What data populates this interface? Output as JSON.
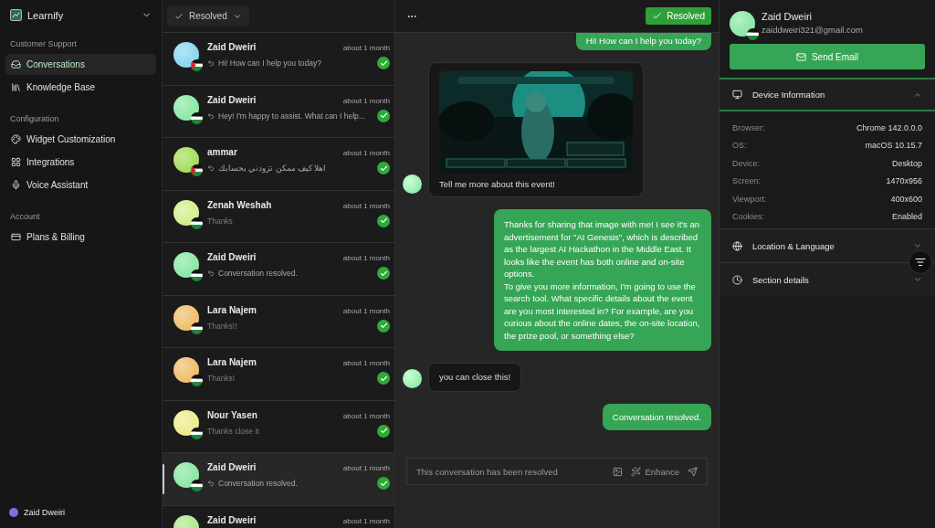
{
  "sidebar": {
    "workspace": "Learnify",
    "sections": [
      {
        "title": "Customer Support",
        "items": [
          {
            "label": "Conversations",
            "selected": true
          },
          {
            "label": "Knowledge Base",
            "selected": false
          }
        ]
      },
      {
        "title": "Configuration",
        "items": [
          {
            "label": "Widget Customization",
            "selected": false
          },
          {
            "label": "Integrations",
            "selected": false
          },
          {
            "label": "Voice Assistant",
            "selected": false
          }
        ]
      },
      {
        "title": "Account",
        "items": [
          {
            "label": "Plans & Billing",
            "selected": false
          }
        ]
      }
    ],
    "user": "Zaid Dweiri"
  },
  "list": {
    "filter": "Resolved",
    "rows": [
      {
        "name": "Zaid Dweiri",
        "time": "about 1 month",
        "preview": "Hi! How can I help you today?",
        "kind": "reply",
        "color": "#8fd8f0",
        "resolved": true,
        "selected": false
      },
      {
        "name": "Zaid Dweiri",
        "time": "about 1 month",
        "preview": "Hey! I'm happy to assist. What can I help...",
        "kind": "reply",
        "color": "#8fe8a8",
        "resolved": true,
        "selected": false
      },
      {
        "name": "ammar",
        "time": "about 1 month",
        "preview": "اهلا كيف ممكن تزودني بحسابك",
        "kind": "reply",
        "color": "#a6e060",
        "resolved": true,
        "selected": false
      },
      {
        "name": "Zenah Weshah",
        "time": "about 1 month",
        "preview": "Thanks",
        "kind": "user",
        "color": "#d4f090",
        "resolved": true,
        "selected": false
      },
      {
        "name": "Zaid Dweiri",
        "time": "about 1 month",
        "preview": "Conversation resolved.",
        "kind": "reply",
        "color": "#8fe8a8",
        "resolved": true,
        "selected": false
      },
      {
        "name": "Lara Najem",
        "time": "about 1 month",
        "preview": "Thanks!!",
        "kind": "user",
        "color": "#f0c070",
        "resolved": true,
        "selected": false
      },
      {
        "name": "Lara Najem",
        "time": "about 1 month",
        "preview": "Thanks!",
        "kind": "user",
        "color": "#f0c070",
        "resolved": true,
        "selected": false
      },
      {
        "name": "Nour Yasen",
        "time": "about 1 month",
        "preview": "Thanks close it",
        "kind": "user",
        "color": "#f0eb90",
        "resolved": true,
        "selected": false
      },
      {
        "name": "Zaid Dweiri",
        "time": "about 1 month",
        "preview": "Conversation resolved.",
        "kind": "reply",
        "color": "#8fe8a8",
        "resolved": true,
        "selected": true
      },
      {
        "name": "Zaid Dweiri",
        "time": "about 1 month",
        "kind": "cut",
        "color": "#b0e890",
        "selected": false
      }
    ]
  },
  "chat": {
    "status": "Resolved",
    "messages": [
      {
        "kind": "agent",
        "text": "Hi! How can I help you today?"
      },
      {
        "kind": "user_image",
        "text": "Tell me more about this event!"
      },
      {
        "kind": "agent",
        "text": "Thanks for sharing that image with me! I see it's an advertisement for \"AI Genesis\", which is described as the largest AI Hackathon in the Middle East. It looks like the event has both online and on-site options.\nTo give you more information, I'm going to use the search tool. What specific details about the event are you most interested in? For example, are you curious about the online dates, the on-site location, the prize pool, or something else?"
      },
      {
        "kind": "user",
        "text": "you can close this!"
      },
      {
        "kind": "agent",
        "text": "Conversation resolved."
      }
    ],
    "composer": {
      "placeholder": "This conversation has been resolved",
      "enhance": "Enhance"
    }
  },
  "contact": {
    "name": "Zaid Dweiri",
    "email": "zaiddweiri321@gmail.com",
    "button": "Send Email",
    "sections": [
      {
        "title": "Device Information",
        "expanded": true,
        "fields": [
          {
            "label": "Browser:",
            "value": "Chrome 142.0.0.0"
          },
          {
            "label": "OS:",
            "value": "macOS 10.15.7"
          },
          {
            "label": "Device:",
            "value": "Desktop"
          },
          {
            "label": "Screen:",
            "value": "1470x956"
          },
          {
            "label": "Viewport:",
            "value": "400x600"
          },
          {
            "label": "Cookies:",
            "value": "Enabled"
          }
        ]
      },
      {
        "title": "Location & Language",
        "expanded": false
      },
      {
        "title": "Section details",
        "expanded": false
      }
    ]
  }
}
